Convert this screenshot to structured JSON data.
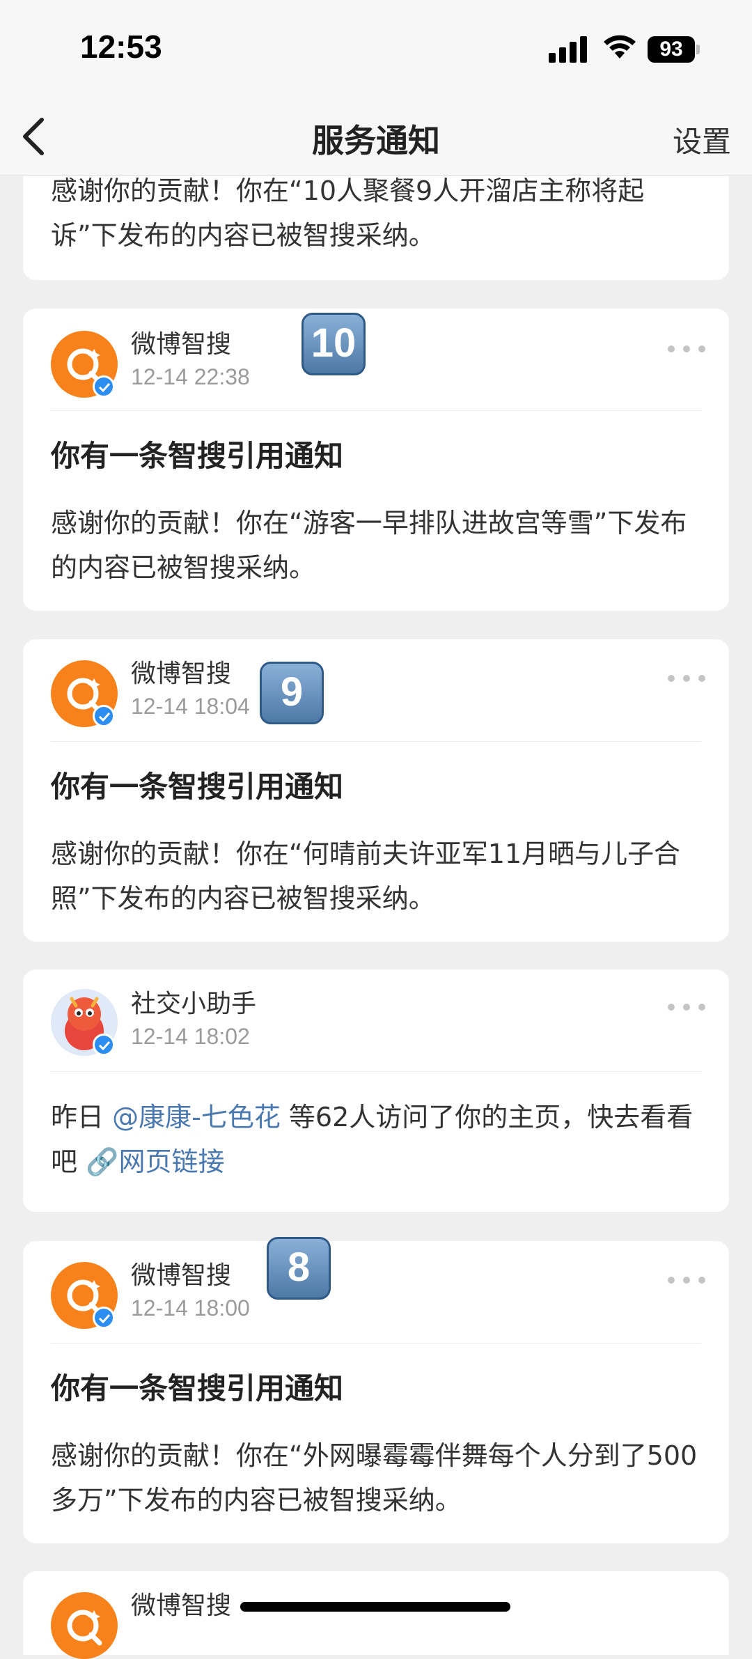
{
  "status": {
    "time": "12:53",
    "battery": "93"
  },
  "nav": {
    "title": "服务通知",
    "settings_label": "设置"
  },
  "top_card": {
    "text": "感谢你的贡献！你在“10人聚餐9人开溜店主称将起诉”下发布的内容已被智搜采纳。"
  },
  "cards": [
    {
      "sender": "微博智搜",
      "time": "12-14 22:38",
      "title": "你有一条智搜引用通知",
      "text": "感谢你的贡献！你在“游客一早排队进故宫等雪”下发布的内容已被智搜采纳。",
      "badge": "10"
    },
    {
      "sender": "微博智搜",
      "time": "12-14 18:04",
      "title": "你有一条智搜引用通知",
      "text": "感谢你的贡献！你在“何晴前夫许亚军11月晒与儿子合照”下发布的内容已被智搜采纳。",
      "badge": "9"
    },
    {
      "sender": "社交小助手",
      "time": "12-14 18:02",
      "text_prefix": "昨日",
      "mention": "@康康-七色花",
      "text_mid": "等62人访问了你的主页，快去看看吧",
      "link": "网页链接"
    },
    {
      "sender": "微博智搜",
      "time": "12-14 18:00",
      "title": "你有一条智搜引用通知",
      "text": "感谢你的贡献！你在“外网曝霉霉伴舞每个人分到了500多万”下发布的内容已被智搜采纳。",
      "badge": "8"
    },
    {
      "sender": "微博智搜"
    }
  ]
}
